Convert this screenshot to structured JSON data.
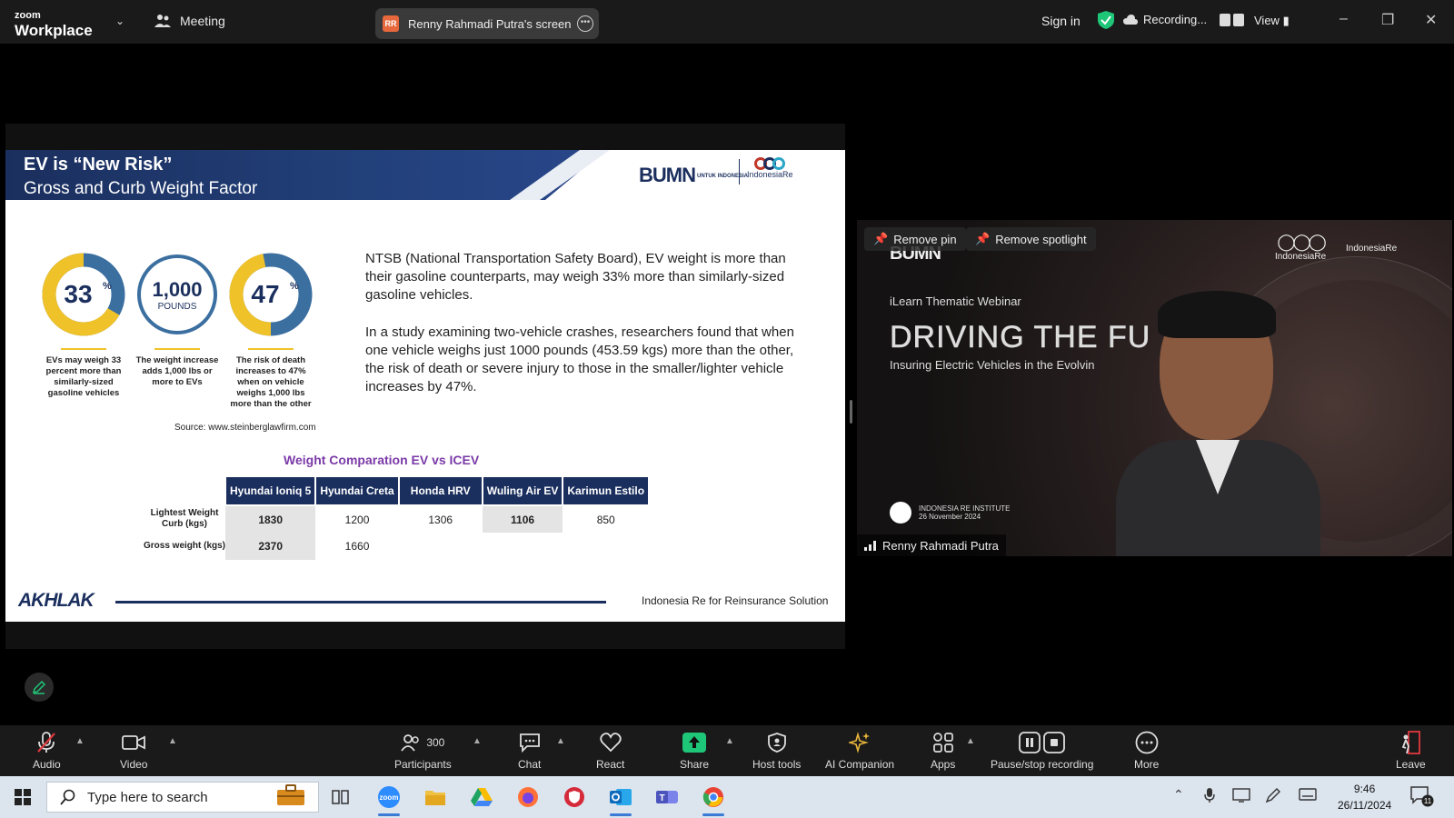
{
  "window": {
    "brand_top": "zoom",
    "brand_bottom": "Workplace",
    "meeting_label": "Meeting",
    "share_initials": "RR",
    "share_label": "Renny Rahmadi Putra's screen",
    "signin_label": "Sign in",
    "recording_label": "Recording...",
    "view_label": "View"
  },
  "slide": {
    "title": "EV is “New Risk”",
    "subtitle": "Gross and Curb Weight Factor",
    "logo_bumn": "BUMN",
    "logo_bumn_small": "UNTUK INDONESIA",
    "logo_ire": "IndonesiaRe",
    "stats": [
      {
        "value": "33",
        "unit": "%",
        "caption": "EVs may weigh 33 percent more than similarly-sized gasoline vehicles"
      },
      {
        "value": "1,000",
        "unit": "POUNDS",
        "caption": "The weight increase adds 1,000 lbs or more to EVs"
      },
      {
        "value": "47",
        "unit": "%",
        "caption": "The risk of death increases to 47% when on vehicle weighs 1,000 lbs more than the other"
      }
    ],
    "source": "Source: www.steinberglawfirm.com",
    "paragraph1": "NTSB (National Transportation Safety Board), EV weight is more than their gasoline counterparts, may weigh 33% more than similarly-sized gasoline vehicles.",
    "paragraph2": "In a study examining two-vehicle crashes, researchers found that when one vehicle weighs just 1000 pounds (453.59 kgs) more than the other, the risk of death or severe injury to those in the smaller/lighter vehicle increases by 47%.",
    "table_title": "Weight Comparation EV vs ICEV",
    "table": {
      "headers": [
        "Hyundai Ioniq 5",
        "Hyundai Creta",
        "Honda HRV",
        "Wuling Air EV",
        "Karimun Estilo"
      ],
      "rows": [
        {
          "label": "Lightest Weight Curb (kgs)",
          "cells": [
            "1830",
            "1200",
            "1306",
            "1106",
            "850"
          ]
        },
        {
          "label": "Gross weight (kgs)",
          "cells": [
            "2370",
            "1660",
            "",
            "",
            ""
          ]
        }
      ]
    },
    "footer_logo": "AKHLAK",
    "footer_text": "Indonesia Re for Reinsurance Solution"
  },
  "video": {
    "remove_pin": "Remove pin",
    "remove_spotlight": "Remove spotlight",
    "bg_logo_bumn": "BUMN",
    "bg_logo_ire": "IndonesiaRe",
    "bg_logo_ire2": "IndonesiaRe",
    "bg_ilearn": "iLearn Thematic Webinar",
    "bg_driving": "DRIVING THE FU",
    "bg_insuring": "Insuring Electric Vehicles in the Evolvin",
    "bg_institute": "INDONESIA RE INSTITUTE",
    "bg_date": "26 November 2024",
    "participant_name": "Renny Rahmadi Putra"
  },
  "toolbar": {
    "audio": "Audio",
    "video": "Video",
    "participants": "Participants",
    "participants_count": "300",
    "chat": "Chat",
    "react": "React",
    "share": "Share",
    "host_tools": "Host tools",
    "ai_companion": "AI Companion",
    "apps": "Apps",
    "pause_stop": "Pause/stop recording",
    "more": "More",
    "leave": "Leave"
  },
  "taskbar": {
    "search_placeholder": "Type here to search",
    "time": "9:46",
    "date": "26/11/2024",
    "notif_count": "11"
  },
  "colors": {
    "accent_navy": "#1b2f5e",
    "ring_yellow": "#f0c22a",
    "ring_blue": "#3b6fa0",
    "table_title_purple": "#7b3aa8",
    "share_green": "#1ec677"
  }
}
